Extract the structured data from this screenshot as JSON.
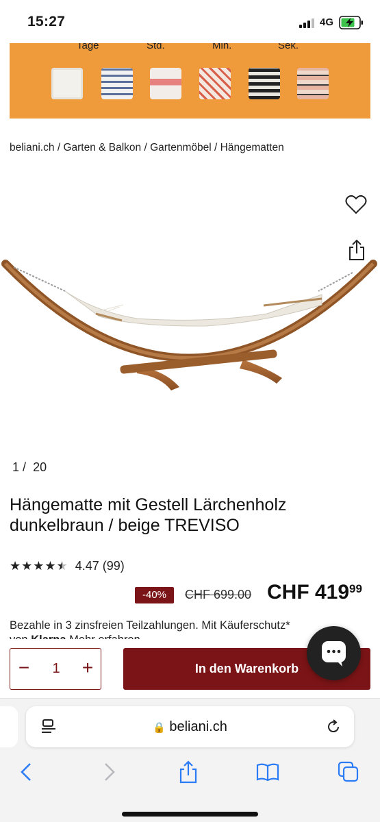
{
  "status_bar": {
    "time": "15:27",
    "network": "4G"
  },
  "banner": {
    "countdown_labels": [
      "Tage",
      "Std.",
      "Min.",
      "Sek."
    ]
  },
  "breadcrumb": {
    "items": [
      "beliani.ch",
      "Garten & Balkon",
      "Gartenmöbel",
      "Hängematten"
    ],
    "separator": "/"
  },
  "gallery": {
    "counter_current": "1",
    "counter_sep": "/",
    "counter_total": "20"
  },
  "product": {
    "title": "Hängematte mit Gestell Lärchenholz dunkelbraun / beige TREVISO",
    "rating_text": "4.47 (99)",
    "rating_value": 4.47,
    "discount": "-40%",
    "old_price": "CHF 699.00",
    "new_price_main": "CHF 419",
    "new_price_cents": "99",
    "payment_line1": "Bezahle in 3 zinsfreien Teilzahlungen. Mit Käuferschutz*",
    "payment_line2_prefix": "von",
    "payment_brand": "Klarna",
    "payment_line2_suffix": "Mehr erfahren"
  },
  "purchase": {
    "minus": "−",
    "quantity": "1",
    "plus": "+",
    "cart_label": "In den Warenkorb"
  },
  "browser": {
    "url": "beliani.ch"
  },
  "colors": {
    "brand": "#7b1416",
    "banner": "#ef9a3b"
  }
}
